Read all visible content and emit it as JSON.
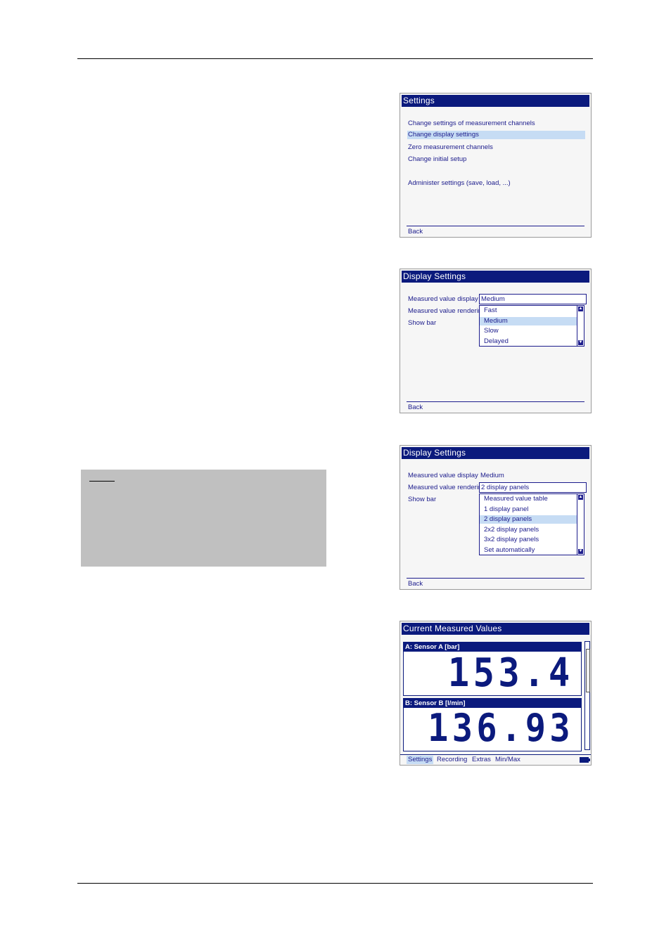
{
  "settings_screen": {
    "title": "Settings",
    "items": [
      {
        "label": "Change settings of measurement channels",
        "selected": false
      },
      {
        "label": "Change display settings",
        "selected": true
      },
      {
        "label": "Zero measurement channels",
        "selected": false
      },
      {
        "label": "Change initial setup",
        "selected": false
      },
      {
        "label": "Administer settings (save, load, ...)",
        "selected": false
      }
    ],
    "back_label": "Back"
  },
  "display_settings_1": {
    "title": "Display Settings",
    "fields": {
      "measured_value_display": "Measured value display",
      "measured_value_rendering": "Measured value renderin",
      "show_bar": "Show bar"
    },
    "current_value": "Medium",
    "dropdown_options": [
      "Fast",
      "Medium",
      "Slow",
      "Delayed"
    ],
    "selected_option": "Medium",
    "back_label": "Back"
  },
  "display_settings_2": {
    "title": "Display Settings",
    "fields": {
      "measured_value_display": "Measured value display",
      "measured_value_rendering": "Measured value renderin",
      "show_bar": "Show bar"
    },
    "display_value": "Medium",
    "current_value": "2 display panels",
    "dropdown_options": [
      "Measured value table",
      "1 display panel",
      "2 display panels",
      "2x2 display panels",
      "3x2 display panels",
      "Set automatically"
    ],
    "selected_option": "2 display panels",
    "back_label": "Back"
  },
  "measured_values_screen": {
    "title": "Current Measured Values",
    "panels": [
      {
        "header": "A: Sensor A [bar]",
        "value": "153.4"
      },
      {
        "header": "B: Sensor B [l/min]",
        "value": "136.93"
      }
    ],
    "tabs": [
      {
        "label": "Settings",
        "selected": true
      },
      {
        "label": "Recording",
        "selected": false
      },
      {
        "label": "Extras",
        "selected": false
      },
      {
        "label": "Min/Max",
        "selected": false
      }
    ]
  },
  "colors": {
    "title_bar": "#0b1a7d",
    "selection": "#c6dcf4",
    "text": "#1c1c8c",
    "note_background": "#c0c0c0"
  }
}
